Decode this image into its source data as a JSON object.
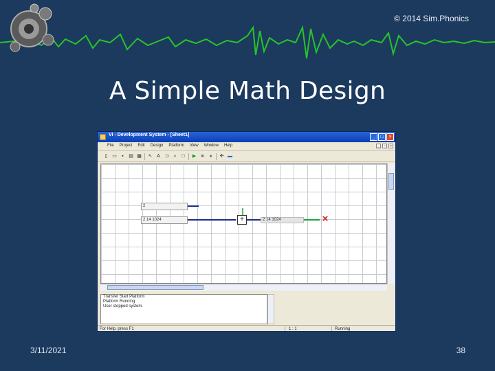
{
  "slide": {
    "copyright": "© 2014 Sim.Phonics",
    "title": "A Simple Math Design",
    "date": "3/11/2021",
    "slide_number": "38",
    "background_color": "#1c3a5e",
    "waveform_color": "#28c428"
  },
  "app": {
    "window_title": "Vi - Development System - [Sheet1]",
    "menu": [
      "File",
      "Project",
      "Edit",
      "Design",
      "Platform",
      "View",
      "Window",
      "Help"
    ],
    "mdi_buttons": [
      "minimize",
      "restore",
      "close"
    ],
    "toolbar_icons": [
      "new-icon",
      "open-icon",
      "save-icon",
      "print-icon",
      "grid-icon",
      "pointer-icon",
      "text-icon",
      "label-icon",
      "search-icon",
      "zoom-icon",
      "run-icon",
      "stop-icon",
      "pause-icon",
      "connect-icon",
      "probe-icon"
    ],
    "inputs": [
      {
        "value": "2"
      },
      {
        "value": "2 14 1024"
      }
    ],
    "output_value": "2 14 1024",
    "messages": [
      "Transfer Start Platform",
      "Platform Running",
      "User stopped system."
    ],
    "status": {
      "left": "For Help, press F1",
      "mid": "1 : 1",
      "right": "Running"
    },
    "accent_colors": {
      "wire": "#1b2b8a",
      "output_wire": "#1aa33a",
      "sink": "#d82020"
    }
  }
}
